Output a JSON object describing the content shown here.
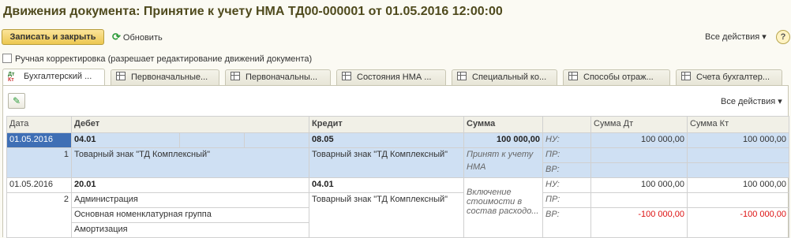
{
  "title": "Движения документа: Принятие к учету НМА ТД00-000001 от 01.05.2016 12:00:00",
  "toolbar": {
    "save_close": "Записать и закрыть",
    "refresh": "Обновить",
    "all_actions": "Все действия",
    "help": "?"
  },
  "manual_correction": "Ручная корректировка (разрешает редактирование движений документа)",
  "tabs": [
    {
      "label": "Бухгалтерский ...",
      "icon": "dt-kt-icon"
    },
    {
      "label": "Первоначальные...",
      "icon": "table-icon"
    },
    {
      "label": "Первоначальны...",
      "icon": "table-icon"
    },
    {
      "label": "Состояния НМА ...",
      "icon": "table-icon"
    },
    {
      "label": "Специальный ко...",
      "icon": "table-icon"
    },
    {
      "label": "Способы отраж...",
      "icon": "table-icon"
    },
    {
      "label": "Счета бухгалтер...",
      "icon": "table-icon"
    }
  ],
  "icon_labels": {
    "dt": "Дт",
    "kt": "Кт"
  },
  "panel": {
    "all_actions": "Все действия"
  },
  "table": {
    "headers": {
      "date": "Дата",
      "debit": "Дебет",
      "credit": "Кредит",
      "sum": "Сумма",
      "sum_dt": "Сумма Дт",
      "sum_kt": "Сумма Кт"
    },
    "rows": [
      {
        "date": "01.05.2016",
        "num": "1",
        "debit_account": "04.01",
        "debit_subconto": [
          "Товарный знак \"ТД Комплексный\""
        ],
        "credit_account": "08.05",
        "credit_subconto": [
          "Товарный знак \"ТД Комплексный\""
        ],
        "sum": "100 000,00",
        "content": "Принят к учету НМА",
        "nu": "НУ:",
        "pr": "ПР:",
        "vr": "ВР:",
        "nu_dt": "100 000,00",
        "nu_kt": "100 000,00",
        "vr_dt": "",
        "vr_kt": ""
      },
      {
        "date": "01.05.2016",
        "num": "2",
        "debit_account": "20.01",
        "debit_subconto": [
          "Администрация",
          "Основная номенклатурная группа",
          "Амортизация"
        ],
        "credit_account": "04.01",
        "credit_subconto": [
          "Товарный знак \"ТД Комплексный\""
        ],
        "sum": "",
        "content": "Включение стоимости в состав расходо...",
        "nu": "НУ:",
        "pr": "ПР:",
        "vr": "ВР:",
        "nu_dt": "100 000,00",
        "nu_kt": "100 000,00",
        "vr_dt": "-100 000,00",
        "vr_kt": "-100 000,00"
      }
    ]
  },
  "colors": {
    "title": "#4f4a1d",
    "accent": "#ecc750",
    "selected_row": "#cfe0f3",
    "negative": "#dd1111"
  }
}
